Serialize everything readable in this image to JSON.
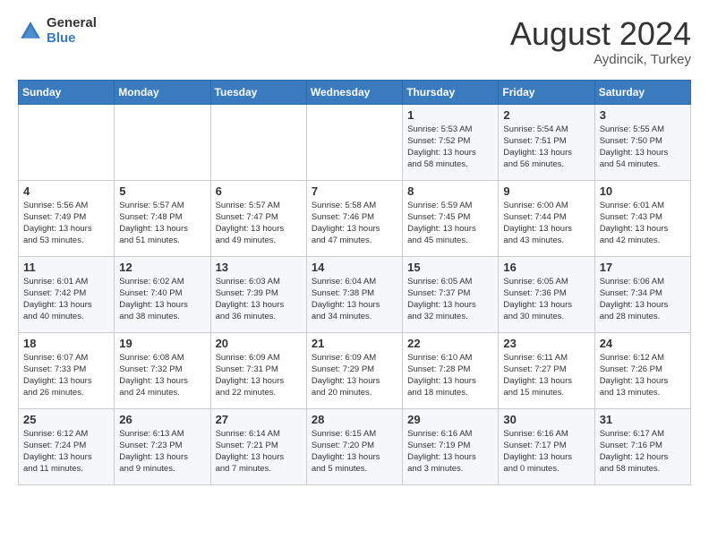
{
  "header": {
    "logo_general": "General",
    "logo_blue": "Blue",
    "title": "August 2024",
    "location": "Aydincik, Turkey"
  },
  "days_of_week": [
    "Sunday",
    "Monday",
    "Tuesday",
    "Wednesday",
    "Thursday",
    "Friday",
    "Saturday"
  ],
  "weeks": [
    [
      {
        "day": "",
        "info": ""
      },
      {
        "day": "",
        "info": ""
      },
      {
        "day": "",
        "info": ""
      },
      {
        "day": "",
        "info": ""
      },
      {
        "day": "1",
        "info": "Sunrise: 5:53 AM\nSunset: 7:52 PM\nDaylight: 13 hours\nand 58 minutes."
      },
      {
        "day": "2",
        "info": "Sunrise: 5:54 AM\nSunset: 7:51 PM\nDaylight: 13 hours\nand 56 minutes."
      },
      {
        "day": "3",
        "info": "Sunrise: 5:55 AM\nSunset: 7:50 PM\nDaylight: 13 hours\nand 54 minutes."
      }
    ],
    [
      {
        "day": "4",
        "info": "Sunrise: 5:56 AM\nSunset: 7:49 PM\nDaylight: 13 hours\nand 53 minutes."
      },
      {
        "day": "5",
        "info": "Sunrise: 5:57 AM\nSunset: 7:48 PM\nDaylight: 13 hours\nand 51 minutes."
      },
      {
        "day": "6",
        "info": "Sunrise: 5:57 AM\nSunset: 7:47 PM\nDaylight: 13 hours\nand 49 minutes."
      },
      {
        "day": "7",
        "info": "Sunrise: 5:58 AM\nSunset: 7:46 PM\nDaylight: 13 hours\nand 47 minutes."
      },
      {
        "day": "8",
        "info": "Sunrise: 5:59 AM\nSunset: 7:45 PM\nDaylight: 13 hours\nand 45 minutes."
      },
      {
        "day": "9",
        "info": "Sunrise: 6:00 AM\nSunset: 7:44 PM\nDaylight: 13 hours\nand 43 minutes."
      },
      {
        "day": "10",
        "info": "Sunrise: 6:01 AM\nSunset: 7:43 PM\nDaylight: 13 hours\nand 42 minutes."
      }
    ],
    [
      {
        "day": "11",
        "info": "Sunrise: 6:01 AM\nSunset: 7:42 PM\nDaylight: 13 hours\nand 40 minutes."
      },
      {
        "day": "12",
        "info": "Sunrise: 6:02 AM\nSunset: 7:40 PM\nDaylight: 13 hours\nand 38 minutes."
      },
      {
        "day": "13",
        "info": "Sunrise: 6:03 AM\nSunset: 7:39 PM\nDaylight: 13 hours\nand 36 minutes."
      },
      {
        "day": "14",
        "info": "Sunrise: 6:04 AM\nSunset: 7:38 PM\nDaylight: 13 hours\nand 34 minutes."
      },
      {
        "day": "15",
        "info": "Sunrise: 6:05 AM\nSunset: 7:37 PM\nDaylight: 13 hours\nand 32 minutes."
      },
      {
        "day": "16",
        "info": "Sunrise: 6:05 AM\nSunset: 7:36 PM\nDaylight: 13 hours\nand 30 minutes."
      },
      {
        "day": "17",
        "info": "Sunrise: 6:06 AM\nSunset: 7:34 PM\nDaylight: 13 hours\nand 28 minutes."
      }
    ],
    [
      {
        "day": "18",
        "info": "Sunrise: 6:07 AM\nSunset: 7:33 PM\nDaylight: 13 hours\nand 26 minutes."
      },
      {
        "day": "19",
        "info": "Sunrise: 6:08 AM\nSunset: 7:32 PM\nDaylight: 13 hours\nand 24 minutes."
      },
      {
        "day": "20",
        "info": "Sunrise: 6:09 AM\nSunset: 7:31 PM\nDaylight: 13 hours\nand 22 minutes."
      },
      {
        "day": "21",
        "info": "Sunrise: 6:09 AM\nSunset: 7:29 PM\nDaylight: 13 hours\nand 20 minutes."
      },
      {
        "day": "22",
        "info": "Sunrise: 6:10 AM\nSunset: 7:28 PM\nDaylight: 13 hours\nand 18 minutes."
      },
      {
        "day": "23",
        "info": "Sunrise: 6:11 AM\nSunset: 7:27 PM\nDaylight: 13 hours\nand 15 minutes."
      },
      {
        "day": "24",
        "info": "Sunrise: 6:12 AM\nSunset: 7:26 PM\nDaylight: 13 hours\nand 13 minutes."
      }
    ],
    [
      {
        "day": "25",
        "info": "Sunrise: 6:12 AM\nSunset: 7:24 PM\nDaylight: 13 hours\nand 11 minutes."
      },
      {
        "day": "26",
        "info": "Sunrise: 6:13 AM\nSunset: 7:23 PM\nDaylight: 13 hours\nand 9 minutes."
      },
      {
        "day": "27",
        "info": "Sunrise: 6:14 AM\nSunset: 7:21 PM\nDaylight: 13 hours\nand 7 minutes."
      },
      {
        "day": "28",
        "info": "Sunrise: 6:15 AM\nSunset: 7:20 PM\nDaylight: 13 hours\nand 5 minutes."
      },
      {
        "day": "29",
        "info": "Sunrise: 6:16 AM\nSunset: 7:19 PM\nDaylight: 13 hours\nand 3 minutes."
      },
      {
        "day": "30",
        "info": "Sunrise: 6:16 AM\nSunset: 7:17 PM\nDaylight: 13 hours\nand 0 minutes."
      },
      {
        "day": "31",
        "info": "Sunrise: 6:17 AM\nSunset: 7:16 PM\nDaylight: 12 hours\nand 58 minutes."
      }
    ]
  ]
}
